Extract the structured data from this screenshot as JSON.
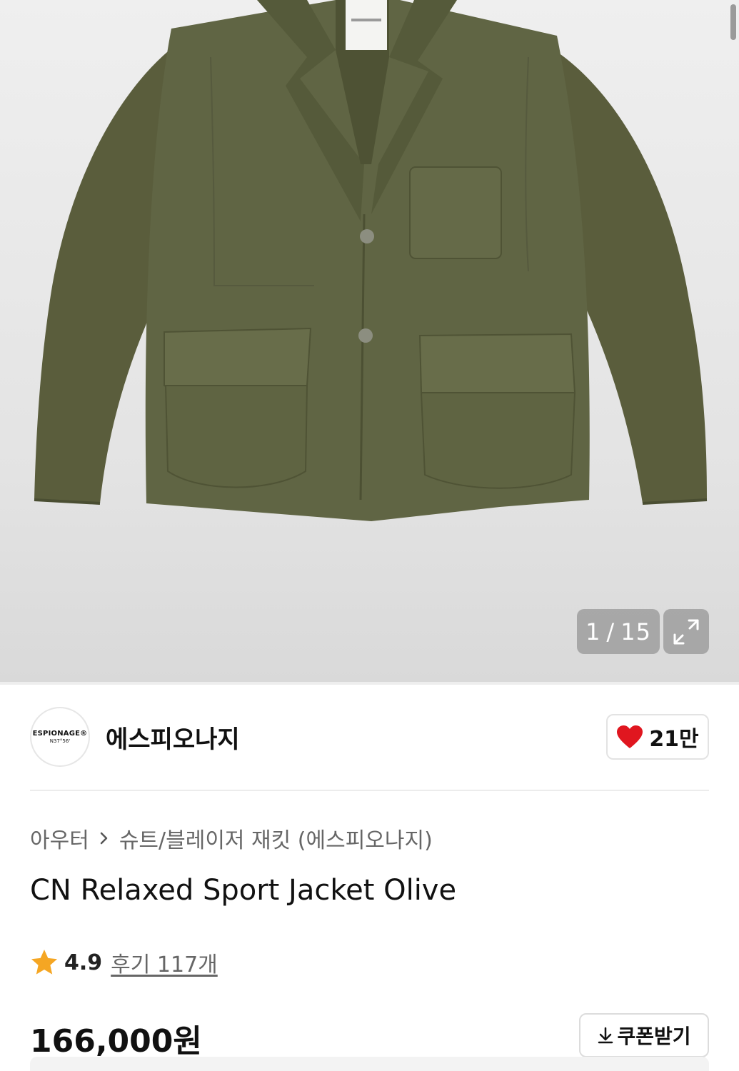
{
  "gallery": {
    "current": "1",
    "separator": "/",
    "total": "15",
    "expand_icon": "expand-icon",
    "product_image": "olive-sport-jacket-photo",
    "image_label": {
      "brand": "ESPIONAGE® N37°56'"
    }
  },
  "brand": {
    "logo_line1": "ESPIONAGE®",
    "logo_line2": "N37°56'",
    "name": "에스피오나지",
    "like_count": "21만",
    "like_icon": "heart-icon",
    "like_color": "#e0161f"
  },
  "breadcrumb": {
    "category": "아우터",
    "subcategory": "슈트/블레이저 재킷 (에스피오나지)",
    "separator_icon": "chevron-right-icon"
  },
  "product": {
    "title": "CN Relaxed Sport Jacket Olive",
    "rating": "4.9",
    "reviews": "후기 117개",
    "star_icon": "star-icon",
    "star_color": "#f5a623",
    "price": "166,000원",
    "coupon_label": "쿠폰받기",
    "coupon_icon": "download-icon"
  }
}
